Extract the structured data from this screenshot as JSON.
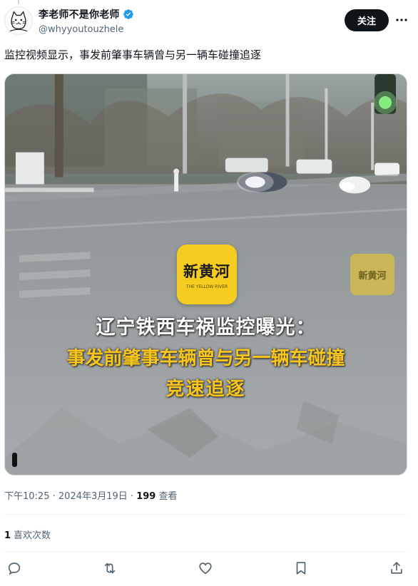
{
  "author": {
    "display_name": "李老师不是你老师",
    "handle": "@whyyoutouzhele",
    "verified": true
  },
  "follow_label": "关注",
  "tweet_text": "监控视频显示，事发前肇事车辆曾与另一辆车碰撞追逐",
  "media": {
    "logo_text": "新黄河",
    "logo_subtext": "THE YELLOW RIVER",
    "watermark_text": "新黄河",
    "caption_line1": "辽宁铁西车祸监控曝光：",
    "caption_line2": "事发前肇事车辆曾与另一辆车碰撞",
    "caption_line3": "竞速追逐"
  },
  "meta": {
    "time": "下午10:25",
    "separator1": " · ",
    "date": "2024年3月19日",
    "separator2": " · ",
    "views_count": "199",
    "views_label": " 查看"
  },
  "engagement": {
    "likes_count": "1",
    "likes_label": "喜欢次数"
  },
  "actions": [
    "reply-icon",
    "retweet-icon",
    "like-icon",
    "bookmark-icon",
    "share-icon"
  ],
  "colors": {
    "follow_bg": "#0f1419",
    "verified": "#1d9bf0",
    "caption_yellow": "#f7c51c",
    "muted": "#536471"
  }
}
